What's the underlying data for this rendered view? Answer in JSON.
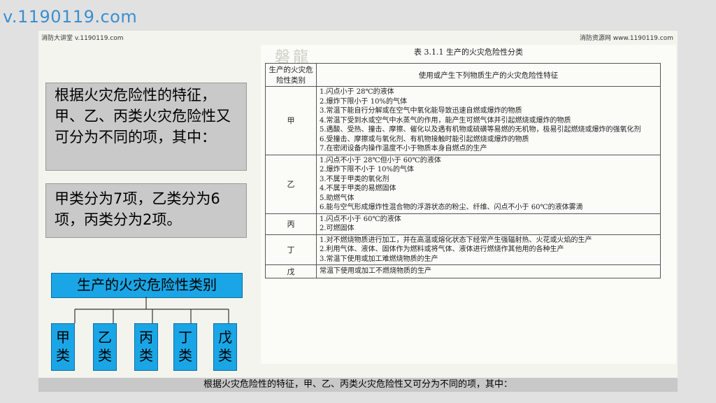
{
  "watermark": "v.1190119.com",
  "header": {
    "left": "消防大讲堂 v.1190119.com",
    "right": "消防资源网 www.1190119.com"
  },
  "box1_text": "根据火灾危险性的特征，甲、乙、丙类火灾危险性又可分为不同的项，其中：",
  "box2_text": "甲类分为7项，乙类分为6项，丙类分为2项。",
  "category_title": "生产的火灾危险性类别",
  "leaves": [
    {
      "top": "甲",
      "bottom": "类"
    },
    {
      "top": "乙",
      "bottom": "类"
    },
    {
      "top": "丙",
      "bottom": "类"
    },
    {
      "top": "丁",
      "bottom": "类"
    },
    {
      "top": "戊",
      "bottom": "类"
    }
  ],
  "table": {
    "logo": "磐龍",
    "title": "表 3.1.1 生产的火灾危险性分类",
    "col1_header": "生产的火灾危险性类别",
    "col2_header": "使用或产生下列物质生产的火灾危险性特征",
    "rows": [
      {
        "cat": "甲",
        "items": [
          "1.闪点小于 28℃的液体",
          "2.爆炸下限小于 10%的气体",
          "3.常温下能自行分解或在空气中氧化能导致迅速自燃或爆炸的物质",
          "4.常温下受到水或空气中水蒸气的作用，能产生可燃气体并引起燃烧或爆炸的物质",
          "5.遇酸、受热、撞击、摩擦、催化以及遇有机物或硫磺等易燃的无机物，极易引起燃烧或爆炸的强氧化剂",
          "6.受撞击、摩擦或与氧化剂、有机物接触时能引起燃烧或爆炸的物质",
          "7.在密闭设备内操作温度不小于物质本身自燃点的生产"
        ]
      },
      {
        "cat": "乙",
        "items": [
          "1.闪点不小于 28℃但小于 60℃的液体",
          "2.爆炸下限不小于 10%的气体",
          "3.不属于甲类的氧化剂",
          "4.不属于甲类的易燃固体",
          "5.助燃气体",
          "6.能与空气形成爆炸性混合物的浮游状态的粉尘、纤维、闪点不小于 60℃的液体雾滴"
        ]
      },
      {
        "cat": "丙",
        "items": [
          "1.闪点不小于 60℃的液体",
          "2.可燃固体"
        ]
      },
      {
        "cat": "丁",
        "items": [
          "1.对不燃烧物质进行加工，并在高温或熔化状态下经常产生强辐射热、火花或火焰的生产",
          "2.利用气体、液体、固体作为燃料或将气体、液体进行燃烧作其他用的各种生产",
          "3.常温下使用或加工难燃烧物质的生产"
        ]
      },
      {
        "cat": "戊",
        "items": [
          "常温下使用或加工不燃烧物质的生产"
        ]
      }
    ]
  },
  "caption": "根据火灾危险性的特征，甲、乙、丙类火灾危险性又可分为不同的项，其中："
}
